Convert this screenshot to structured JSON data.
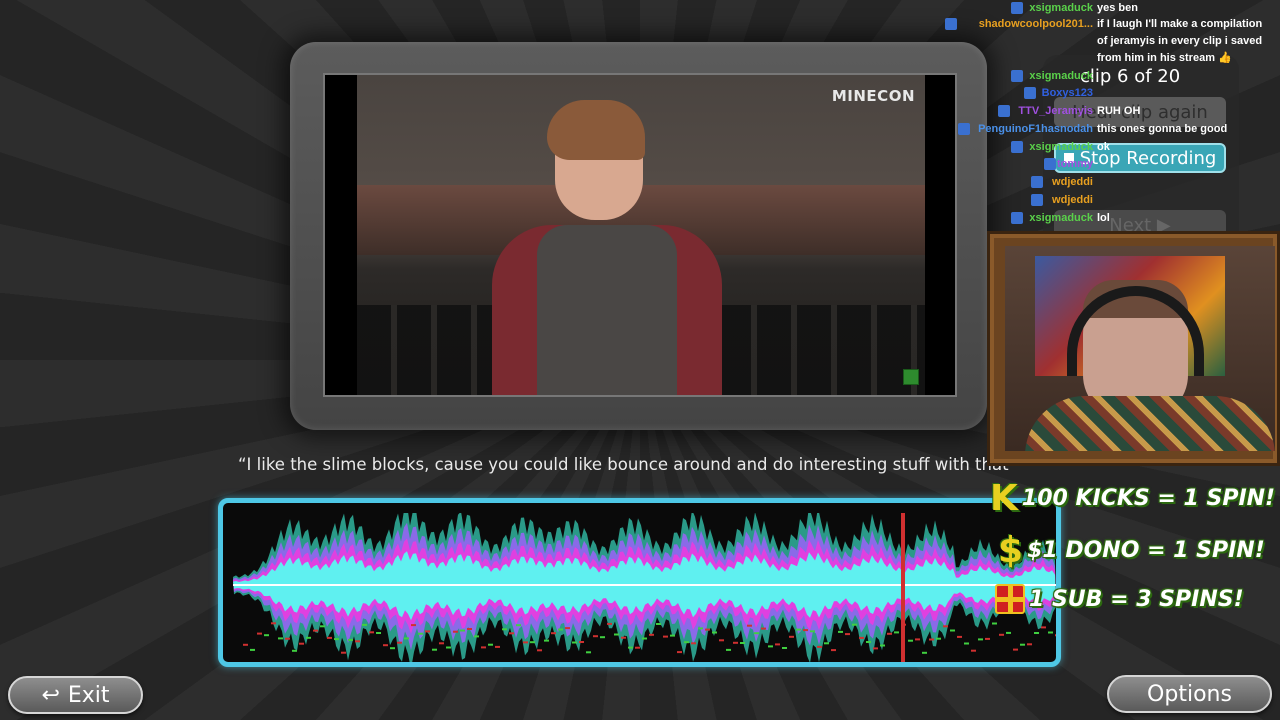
{
  "video": {
    "logo": "MINECON"
  },
  "subtitle": "“I like the slime blocks, cause you could like bounce around and do interesting stuff with that",
  "buttons": {
    "exit": "Exit",
    "options": "Options"
  },
  "clip_panel": {
    "counter": "clip 6 of 20",
    "hear_again": "Hear clip again",
    "stop_recording": "Stop Recording",
    "next": "Next ▶"
  },
  "chat": [
    {
      "user": "xsigmaduck",
      "color": "#5ad04a",
      "text": "yes ben"
    },
    {
      "user": "shadowcoolpool201...",
      "color": "#e8a020",
      "text": "if I laugh I'll make a compilation of jeramyis in every clip i saved from him in his stream 👍"
    },
    {
      "user": "xsigmaduck",
      "color": "#5ad04a",
      "text": ""
    },
    {
      "user": "Boxys123",
      "color": "#3060e0",
      "text": ""
    },
    {
      "user": "TTV_Jeramyis",
      "color": "#a050e0",
      "text": "RUH OH"
    },
    {
      "user": "PenguinoF1hasnodah",
      "color": "#4a90e8",
      "text": "this ones gonna be good"
    },
    {
      "user": "xsigmaduck",
      "color": "#5ad04a",
      "text": "ok"
    },
    {
      "user": "tommy",
      "color": "#a050e0",
      "text": ""
    },
    {
      "user": "wdjeddi",
      "color": "#e8a020",
      "text": ""
    },
    {
      "user": "wdjeddi",
      "color": "#e8a020",
      "text": ""
    },
    {
      "user": "xsigmaduck",
      "color": "#5ad04a",
      "text": "lol"
    }
  ],
  "promo": {
    "kicks": {
      "icon": "K",
      "text": "100 KICKS = 1 SPIN!"
    },
    "dono": {
      "icon": "$",
      "text": "$1 DONO = 1 SPIN!"
    },
    "sub": {
      "icon": "gift-icon",
      "text": "1 SUB = 3 SPINS!"
    }
  },
  "colors": {
    "wave_frame": "#4ec8e6",
    "wave_cyan": "#5ff0f0",
    "wave_teal": "#2a9a88",
    "wave_purple": "#8a6ae8",
    "wave_magenta": "#e040e0",
    "playhead": "#d03030"
  }
}
